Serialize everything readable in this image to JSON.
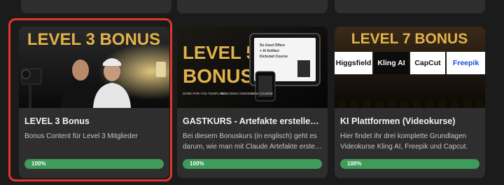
{
  "colors": {
    "background": "#1b1b1b",
    "card": "#2e2e2e",
    "progress_fill": "#3e9b5a",
    "highlight": "#e0362c",
    "gold": "#e2b24a"
  },
  "courses": [
    {
      "banner": "LEVEL 3 BONUS",
      "title": "LEVEL 3 Bonus",
      "description": [
        "Bonus Content für Level 3 Mitglieder"
      ],
      "progress": 100,
      "progress_label": "100%"
    },
    {
      "banner_line1": "LEVEL 5",
      "banner_line2": "BONUS",
      "screen_lines": [
        "So Used Offers",
        "+ AI Artifact",
        "Kickstart Course"
      ],
      "tags": [
        "DONE-FOR-YOU TEMPLATES",
        "NO CODING NEEDED",
        "NEW COURSE"
      ],
      "title": "GASTKURS - Artefakte erstellen (...",
      "description": [
        "Bei diesem Bonuskurs (in englisch) geht es",
        "darum, wie man mit Claude Artefakte erstell..."
      ],
      "progress": 100,
      "progress_label": "100%"
    },
    {
      "banner": "LEVEL 7 BONUS",
      "logos": [
        "Higgsfield",
        "Kling AI",
        "CapCut",
        "Freepik"
      ],
      "title": "KI Plattformen (Videokurse)",
      "description": [
        "Hier findet ihr drei komplette Grundlagen",
        "Videokurse Kling AI, Freepik und Capcut."
      ],
      "progress": 100,
      "progress_label": "100%"
    }
  ]
}
